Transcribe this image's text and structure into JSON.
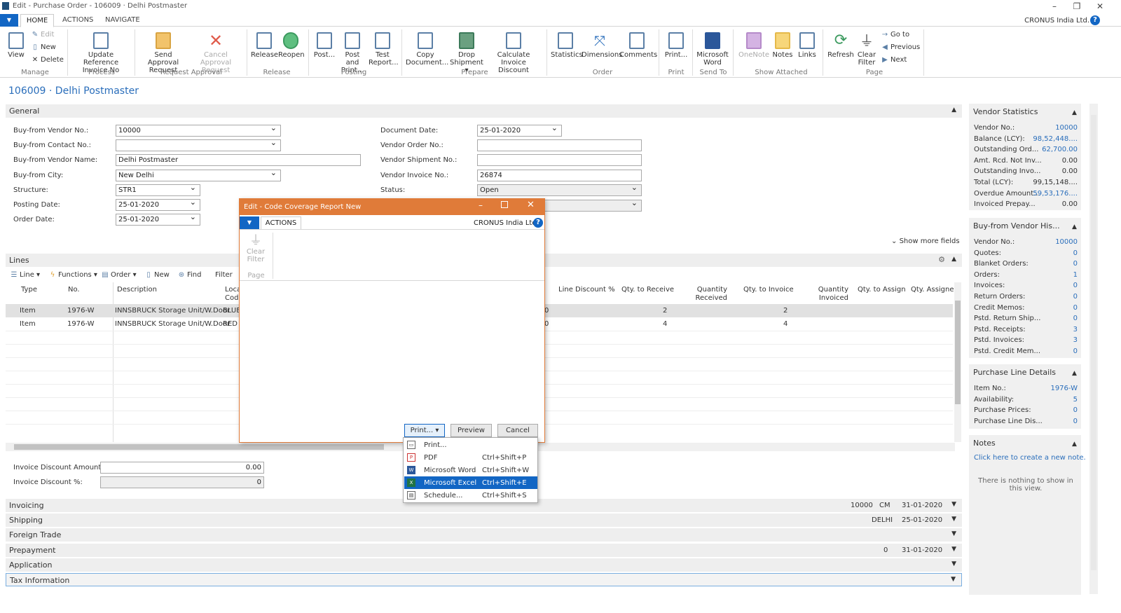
{
  "window": {
    "title": "Edit - Purchase Order - 106009 · Delhi Postmaster",
    "company": "CRONUS India Ltd."
  },
  "tabs": {
    "home": "HOME",
    "actions": "ACTIONS",
    "navigate": "NAVIGATE"
  },
  "ribbon": {
    "view": "View",
    "edit": "Edit",
    "new": "New",
    "delete": "Delete",
    "manage": "Manage",
    "update_ref": "Update Reference Invoice No",
    "process": "Process",
    "send_approval": "Send Approval Request",
    "cancel_approval": "Cancel Approval Request",
    "request_approval": "Request Approval",
    "release": "Release",
    "reopen": "Reopen",
    "release_grp": "Release",
    "post": "Post...",
    "post_print": "Post and Print...",
    "test_report": "Test Report...",
    "posting": "Posting",
    "copy_doc": "Copy Document...",
    "drop_ship": "Drop Shipment ▾",
    "calc_inv": "Calculate Invoice Discount",
    "prepare": "Prepare",
    "statistics": "Statistics",
    "dimensions": "Dimensions",
    "comments": "Comments",
    "order": "Order",
    "print": "Print...",
    "print_grp": "Print",
    "ms_word": "Microsoft Word",
    "send_to": "Send To",
    "onenote": "OneNote",
    "notes": "Notes",
    "links": "Links",
    "show_attached": "Show Attached",
    "refresh": "Refresh",
    "clear_filter": "Clear Filter",
    "goto": "Go to",
    "previous": "Previous",
    "next": "Next",
    "page": "Page"
  },
  "page_title": "106009 · Delhi Postmaster",
  "general": {
    "title": "General",
    "buy_from_vendor_no_lbl": "Buy-from Vendor No.:",
    "buy_from_vendor_no": "10000",
    "buy_from_contact_lbl": "Buy-from Contact No.:",
    "buy_from_contact": "",
    "buy_from_name_lbl": "Buy-from Vendor Name:",
    "buy_from_name": "Delhi Postmaster",
    "buy_from_city_lbl": "Buy-from City:",
    "buy_from_city": "New Delhi",
    "structure_lbl": "Structure:",
    "structure": "STR1",
    "posting_date_lbl": "Posting Date:",
    "posting_date": "25-01-2020",
    "order_date_lbl": "Order Date:",
    "order_date": "25-01-2020",
    "doc_date_lbl": "Document Date:",
    "doc_date": "25-01-2020",
    "vendor_order_lbl": "Vendor Order No.:",
    "vendor_order": "",
    "vendor_ship_lbl": "Vendor Shipment No.:",
    "vendor_ship": "",
    "vendor_inv_lbl": "Vendor Invoice No.:",
    "vendor_inv": "26874",
    "status_lbl": "Status:",
    "status": "Open",
    "show_more": "Show more fields"
  },
  "lines": {
    "title": "Lines",
    "toolbar": {
      "line": "Line ▾",
      "functions": "Functions ▾",
      "order": "Order ▾",
      "new": "New",
      "find": "Find",
      "filter": "Filter"
    },
    "headers": {
      "type": "Type",
      "no": "No.",
      "desc": "Description",
      "loc": "Loca Code",
      "line_disc": "Line Discount %",
      "qty_recv": "Qty. to Receive",
      "qty_received": "Quantity Received",
      "qty_inv": "Qty. to Invoice",
      "qty_invoiced": "Quantity Invoiced",
      "qty_assign": "Qty. to Assign",
      "qty_assigned": "Qty. Assigned"
    },
    "rows": [
      {
        "type": "Item",
        "no": "1976-W",
        "desc": "INNSBRUCK Storage Unit/W.Door",
        "loc": "BLUE",
        "x": "0",
        "qty_recv": "2",
        "qty_inv": "2"
      },
      {
        "type": "Item",
        "no": "1976-W",
        "desc": "INNSBRUCK Storage Unit/W.Door",
        "loc": "RED",
        "x": "0",
        "qty_recv": "4",
        "qty_inv": "4"
      }
    ]
  },
  "totals": {
    "inv_disc_amt_lbl": "Invoice Discount Amount:",
    "inv_disc_amt": "0.00",
    "inv_disc_pct_lbl": "Invoice Discount %:",
    "inv_disc_pct": "0"
  },
  "fasttabs": {
    "invoicing": "Invoicing",
    "inv_s1": "10000",
    "inv_s2": "CM",
    "inv_s3": "31-01-2020",
    "shipping": "Shipping",
    "ship_s1": "DELHI",
    "ship_s2": "25-01-2020",
    "foreign": "Foreign Trade",
    "prepayment": "Prepayment",
    "pre_s1": "0",
    "pre_s2": "31-01-2020",
    "application": "Application",
    "tax": "Tax Information"
  },
  "factbox": {
    "vendor_stats": {
      "title": "Vendor Statistics",
      "items": [
        {
          "l": "Vendor No.:",
          "v": "10000"
        },
        {
          "l": "Balance (LCY):",
          "v": "98,52,448...."
        },
        {
          "l": "Outstanding Ord...",
          "v": "62,700.00"
        },
        {
          "l": "Amt. Rcd. Not Inv...",
          "v": "0.00"
        },
        {
          "l": "Outstanding Invo...",
          "v": "0.00"
        },
        {
          "l": "Total (LCY):",
          "v": "99,15,148...."
        },
        {
          "l": "Overdue Amount...",
          "v": "59,53,176...."
        },
        {
          "l": "Invoiced Prepay...",
          "v": "0.00"
        }
      ]
    },
    "vendor_hist": {
      "title": "Buy-from Vendor His...",
      "items": [
        {
          "l": "Vendor No.:",
          "v": "10000"
        },
        {
          "l": "Quotes:",
          "v": "0"
        },
        {
          "l": "Blanket Orders:",
          "v": "0"
        },
        {
          "l": "Orders:",
          "v": "1"
        },
        {
          "l": "Invoices:",
          "v": "0"
        },
        {
          "l": "Return Orders:",
          "v": "0"
        },
        {
          "l": "Credit Memos:",
          "v": "0"
        },
        {
          "l": "Pstd. Return Ship...",
          "v": "0"
        },
        {
          "l": "Pstd. Receipts:",
          "v": "3"
        },
        {
          "l": "Pstd. Invoices:",
          "v": "3"
        },
        {
          "l": "Pstd. Credit Mem...",
          "v": "0"
        }
      ]
    },
    "pl_details": {
      "title": "Purchase Line Details",
      "items": [
        {
          "l": "Item No.:",
          "v": "1976-W"
        },
        {
          "l": "Availability:",
          "v": "5"
        },
        {
          "l": "Purchase Prices:",
          "v": "0"
        },
        {
          "l": "Purchase Line Dis...",
          "v": "0"
        }
      ]
    },
    "notes": {
      "title": "Notes",
      "link": "Click here to create a new note.",
      "empty": "There is nothing to show in this view."
    }
  },
  "dialog": {
    "title": "Edit - Code Coverage Report New",
    "tab": "ACTIONS",
    "company": "CRONUS India Ltd.",
    "clear_filter": "Clear Filter",
    "page": "Page",
    "print_btn": "Print... ▾",
    "preview_btn": "Preview",
    "cancel_btn": "Cancel",
    "menu": [
      {
        "t": "Print...",
        "k": ""
      },
      {
        "t": "PDF",
        "k": "Ctrl+Shift+P"
      },
      {
        "t": "Microsoft Word",
        "k": "Ctrl+Shift+W"
      },
      {
        "t": "Microsoft Excel",
        "k": "Ctrl+Shift+E"
      },
      {
        "t": "Schedule...",
        "k": "Ctrl+Shift+S"
      }
    ]
  }
}
